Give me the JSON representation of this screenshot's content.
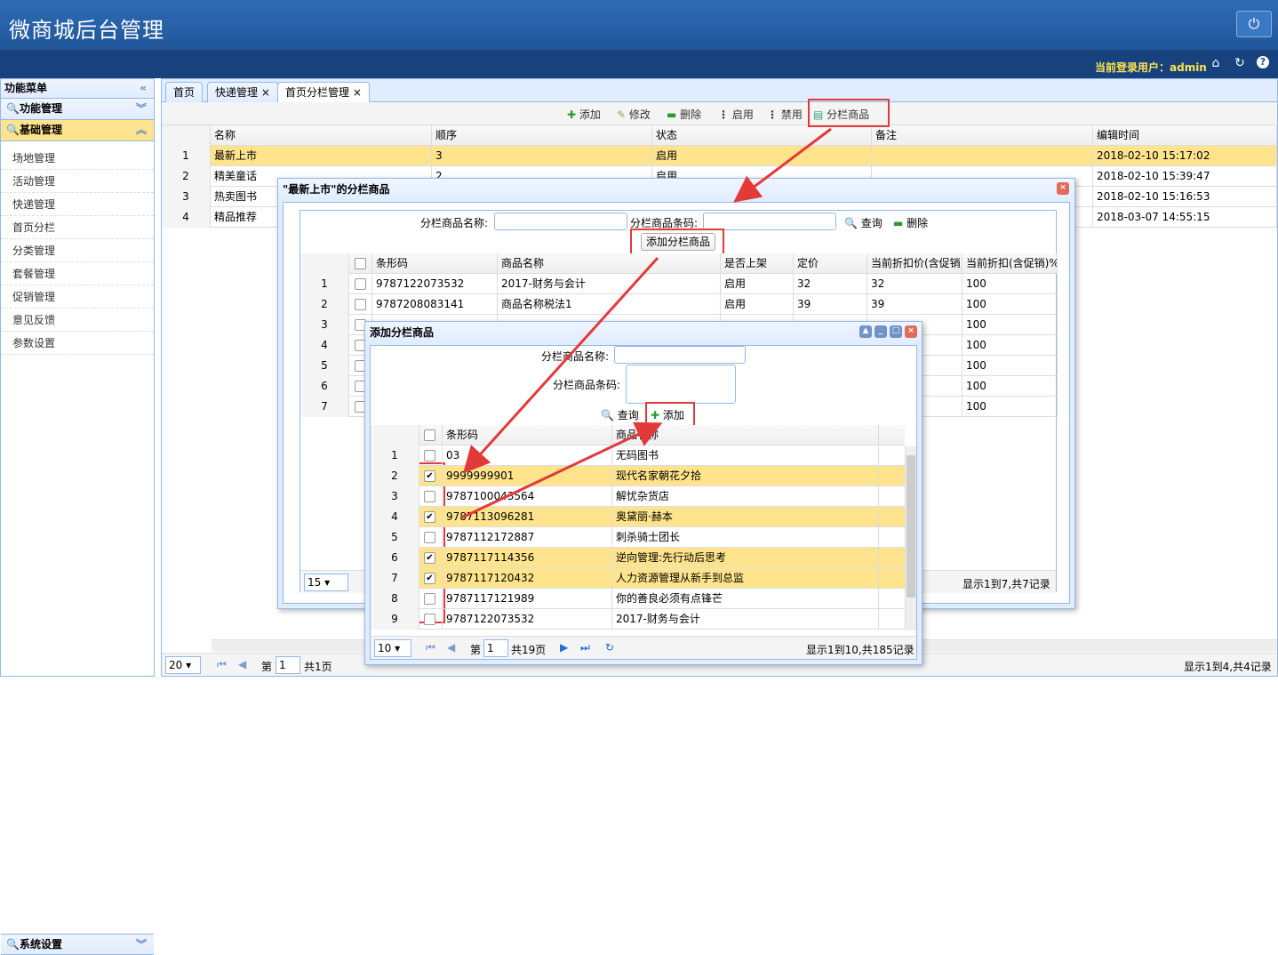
{
  "app": {
    "title": "微商城后台管理",
    "user_text": "当前登录用户：admin"
  },
  "sidebar": {
    "header": "功能菜单",
    "groups": [
      {
        "label": "功能管理"
      },
      {
        "label": "基础管理"
      }
    ],
    "items": [
      "场地管理",
      "活动管理",
      "快递管理",
      "首页分栏",
      "分类管理",
      "套餐管理",
      "促销管理",
      "意见反馈",
      "参数设置"
    ],
    "footer": "系统设置"
  },
  "tabs": [
    {
      "label": "首页"
    },
    {
      "label": "快递管理"
    },
    {
      "label": "首页分栏管理"
    }
  ],
  "toolbar": {
    "add": "添加",
    "edit": "修改",
    "delete": "删除",
    "enable": "启用",
    "disable": "禁用",
    "column_goods": "分栏商品"
  },
  "main_grid": {
    "headers": [
      "名称",
      "顺序",
      "状态",
      "备注",
      "编辑时间"
    ],
    "rows": [
      {
        "n": "1",
        "name": "最新上市",
        "order": "3",
        "status": "启用",
        "note": "",
        "time": "2018-02-10 15:17:02"
      },
      {
        "n": "2",
        "name": "精美童话",
        "order": "2",
        "status": "启用",
        "note": "",
        "time": "2018-02-10 15:39:47"
      },
      {
        "n": "3",
        "name": "热卖图书",
        "order": "",
        "status": "",
        "note": "",
        "time": "2018-02-10 15:16:53"
      },
      {
        "n": "4",
        "name": "精品推荐",
        "order": "",
        "status": "",
        "note": "",
        "time": "2018-03-07 14:55:15"
      }
    ],
    "pager": {
      "size": "20",
      "page_label": "第",
      "page": "1",
      "total_pages": "共1页",
      "summary": "显示1到4,共4记录"
    }
  },
  "dialog1": {
    "title": "\"最新上市\"的分栏商品",
    "name_label": "分栏商品名称:",
    "code_label": "分栏商品条码:",
    "search": "查询",
    "delete": "删除",
    "add_btn": "添加分栏商品",
    "headers": [
      "条形码",
      "商品名称",
      "是否上架",
      "定价",
      "当前折扣价(含促销)",
      "当前折扣(含促销)%"
    ],
    "rows": [
      {
        "n": "1",
        "code": "9787122073532",
        "name": "2017-财务与会计",
        "on": "启用",
        "price": "32",
        "disc": "32",
        "pct": "100"
      },
      {
        "n": "2",
        "code": "9787208083141",
        "name": "商品名称税法1",
        "on": "启用",
        "price": "39",
        "disc": "39",
        "pct": "100"
      },
      {
        "n": "3",
        "pct": "100"
      },
      {
        "n": "4",
        "pct": "100"
      },
      {
        "n": "5",
        "pct": "100"
      },
      {
        "n": "6",
        "pct": "100"
      },
      {
        "n": "7",
        "pct": "100"
      }
    ],
    "pager": {
      "size": "15",
      "summary": "显示1到7,共7记录"
    }
  },
  "dialog2": {
    "title": "添加分栏商品",
    "name_label": "分栏商品名称:",
    "code_label": "分栏商品条码:",
    "search": "查询",
    "add": "添加",
    "headers": [
      "条形码",
      "商品名称"
    ],
    "rows": [
      {
        "n": "1",
        "code": "03",
        "name": "无码图书",
        "checked": false,
        "sel": false
      },
      {
        "n": "2",
        "code": "9999999901",
        "name": "现代名家朝花夕拾",
        "checked": true,
        "sel": true
      },
      {
        "n": "3",
        "code": "9787100043564",
        "name": "解忧杂货店",
        "checked": false,
        "sel": false
      },
      {
        "n": "4",
        "code": "9787113096281",
        "name": "奥黛丽·赫本",
        "checked": true,
        "sel": true
      },
      {
        "n": "5",
        "code": "9787112172887",
        "name": "刺杀骑士团长",
        "checked": false,
        "sel": false
      },
      {
        "n": "6",
        "code": "9787117114356",
        "name": "逆向管理:先行动后思考",
        "checked": true,
        "sel": true
      },
      {
        "n": "7",
        "code": "9787117120432",
        "name": "人力资源管理从新手到总监",
        "checked": true,
        "sel": true
      },
      {
        "n": "8",
        "code": "9787117121989",
        "name": "你的善良必须有点锋芒",
        "checked": false,
        "sel": false
      },
      {
        "n": "9",
        "code": "9787122073532",
        "name": "2017-财务与会计",
        "checked": false,
        "sel": false
      }
    ],
    "pager": {
      "size": "10",
      "page_label": "第",
      "page": "1",
      "total_pages": "共19页",
      "summary": "显示1到10,共185记录"
    }
  },
  "colors": {
    "header_blue": "#1f5599",
    "highlight": "#ffe48d",
    "annotation_red": "#e23a3a"
  }
}
